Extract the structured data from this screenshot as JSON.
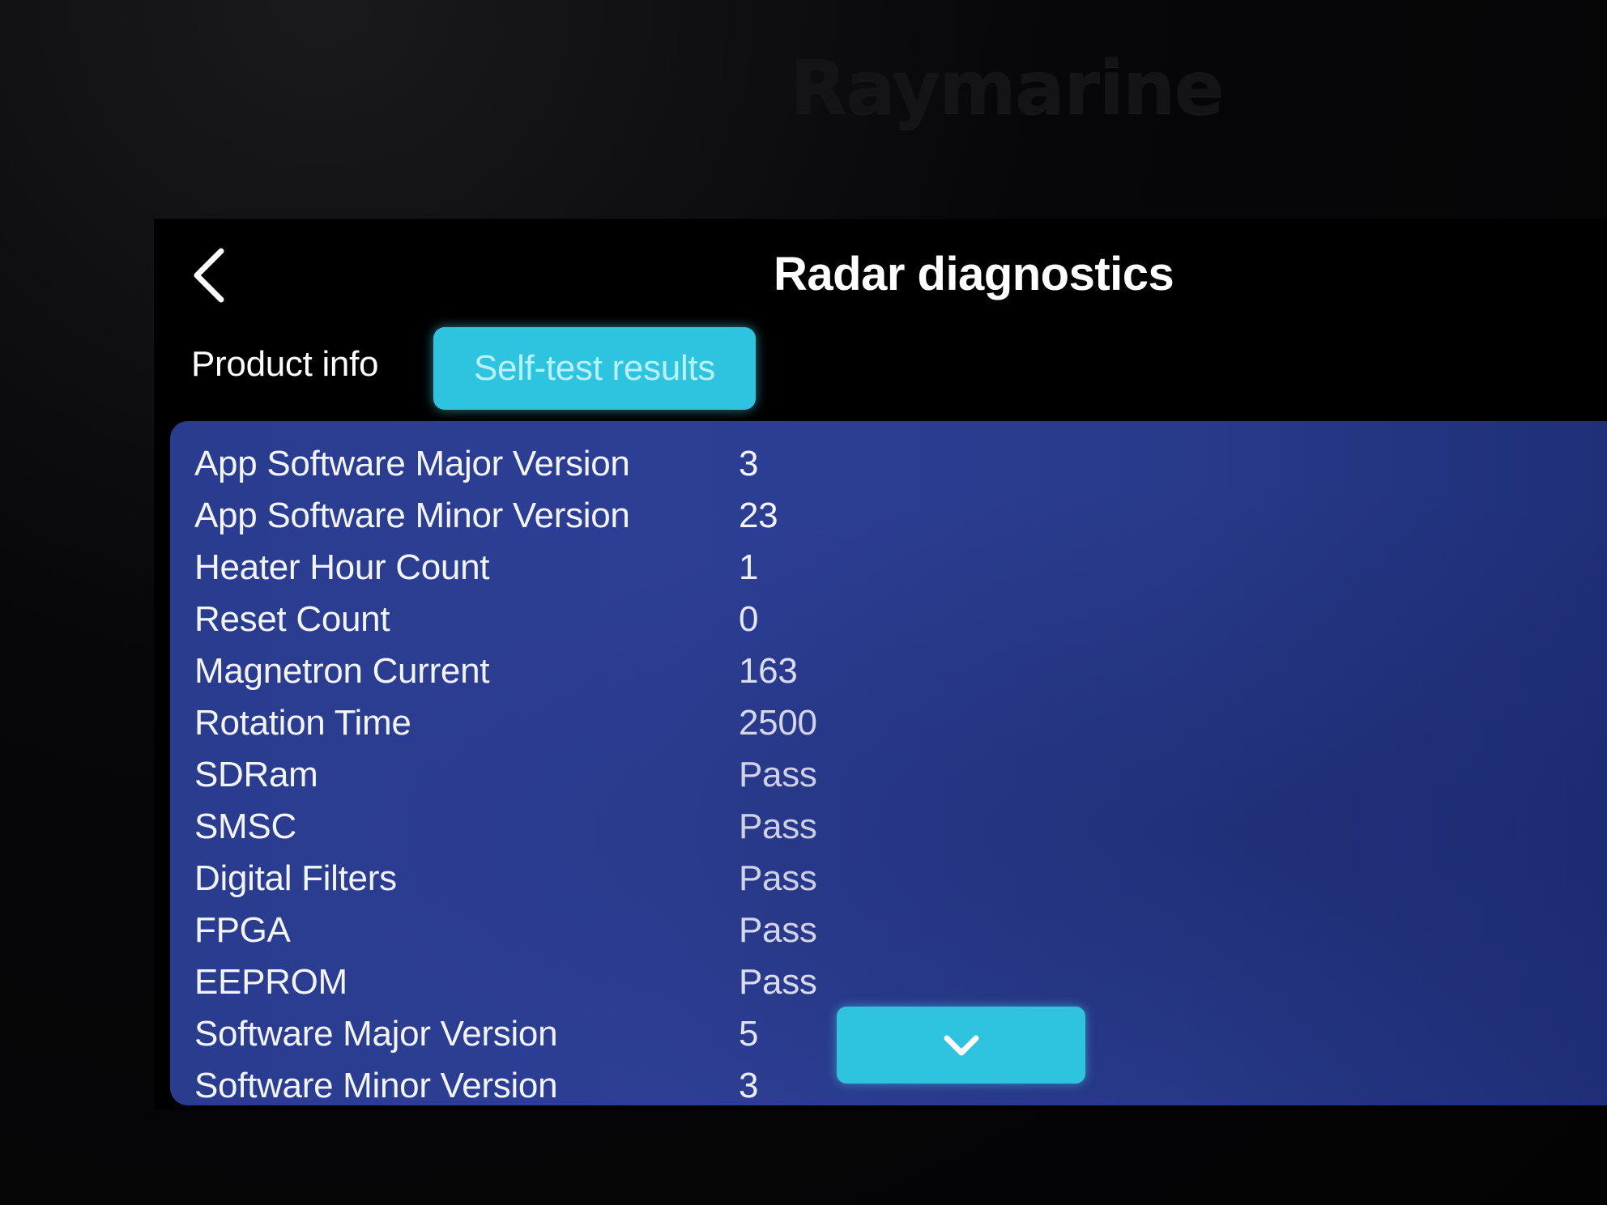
{
  "brand": "Raymarine",
  "header": {
    "title": "Radar diagnostics",
    "back_icon": "chevron-left-icon"
  },
  "tabs": [
    {
      "label": "Product info",
      "active": false
    },
    {
      "label": "Self-test results",
      "active": true
    }
  ],
  "results": [
    {
      "label": "App Software Major Version",
      "value": "3"
    },
    {
      "label": "App Software Minor Version",
      "value": "23"
    },
    {
      "label": "Heater Hour Count",
      "value": "1"
    },
    {
      "label": "Reset Count",
      "value": "0"
    },
    {
      "label": "Magnetron Current",
      "value": "163"
    },
    {
      "label": "Rotation Time",
      "value": "2500"
    },
    {
      "label": "SDRam",
      "value": "Pass"
    },
    {
      "label": "SMSC",
      "value": "Pass"
    },
    {
      "label": "Digital Filters",
      "value": "Pass"
    },
    {
      "label": "FPGA",
      "value": "Pass"
    },
    {
      "label": "EEPROM",
      "value": "Pass"
    },
    {
      "label": "Software Major Version",
      "value": "5"
    },
    {
      "label": "Software Minor Version",
      "value": "3"
    }
  ],
  "scroll_button": {
    "icon": "chevron-down-icon"
  },
  "colors": {
    "accent": "#2ec4e0",
    "panel": "#2a3c8e",
    "background": "#000000"
  }
}
